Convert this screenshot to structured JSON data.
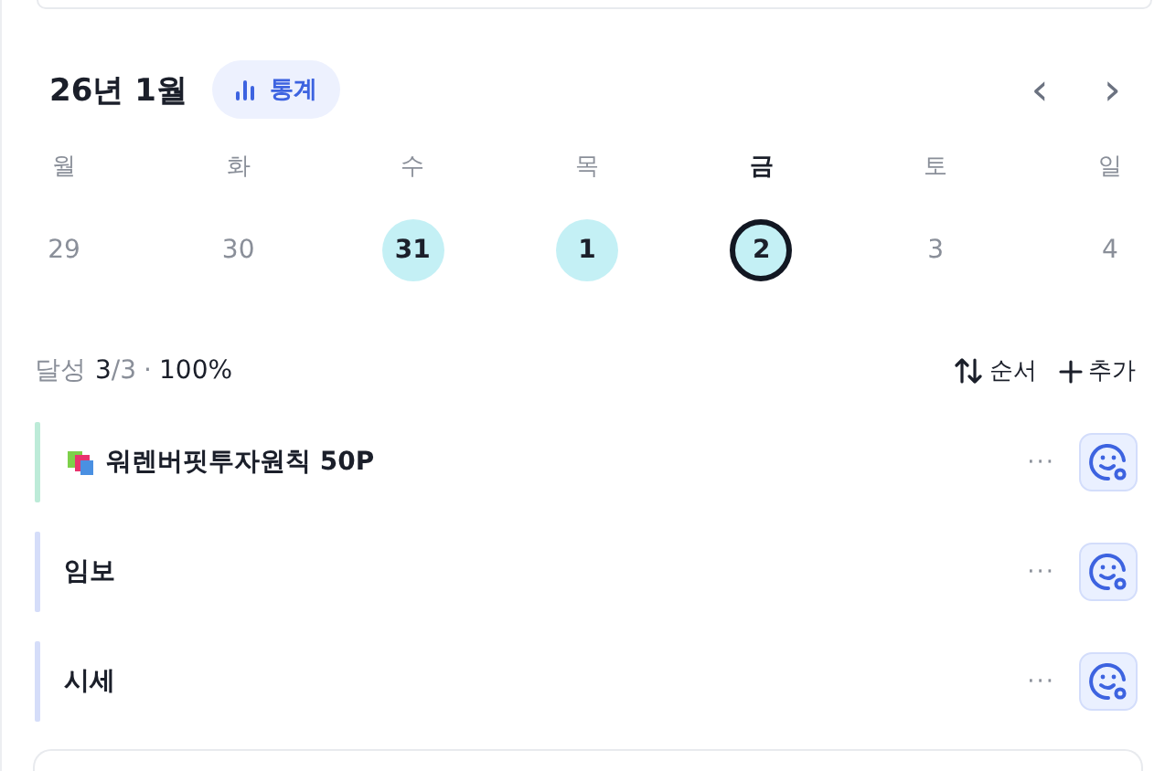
{
  "header": {
    "title": "26년 1월",
    "stats_button": "통계",
    "prev": "‹",
    "next": "›"
  },
  "weekdays": [
    {
      "label": "월",
      "selected": false
    },
    {
      "label": "화",
      "selected": false
    },
    {
      "label": "수",
      "selected": false
    },
    {
      "label": "목",
      "selected": false
    },
    {
      "label": "금",
      "selected": true
    },
    {
      "label": "토",
      "selected": false
    },
    {
      "label": "일",
      "selected": false
    }
  ],
  "days": [
    {
      "label": "29",
      "done": false,
      "selected": false
    },
    {
      "label": "30",
      "done": false,
      "selected": false
    },
    {
      "label": "31",
      "done": true,
      "selected": false
    },
    {
      "label": "1",
      "done": true,
      "selected": false
    },
    {
      "label": "2",
      "done": true,
      "selected": true
    },
    {
      "label": "3",
      "done": false,
      "selected": false
    },
    {
      "label": "4",
      "done": false,
      "selected": false
    }
  ],
  "summary": {
    "label": "달성",
    "done": "3",
    "total": "/3",
    "separator": "·",
    "percent": "100%",
    "sort_button": "순서",
    "add_button": "추가"
  },
  "tasks": [
    {
      "title": "워렌버핏투자원칙 50P",
      "icon": true,
      "color": "#bdebd8",
      "more": "···"
    },
    {
      "title": "임보",
      "icon": false,
      "color": "#d5ddf9",
      "more": "···"
    },
    {
      "title": "시세",
      "icon": false,
      "color": "#d5ddf9",
      "more": "···"
    }
  ]
}
